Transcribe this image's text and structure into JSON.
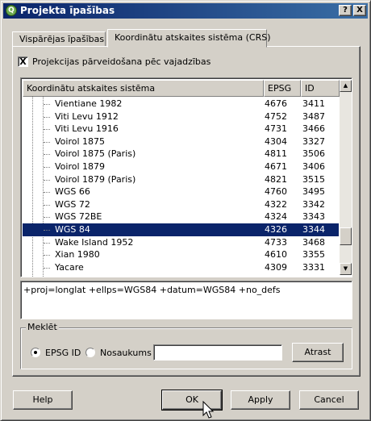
{
  "window": {
    "title": "Projekta īpašības"
  },
  "titlebar_buttons": {
    "help": "?",
    "close": "X"
  },
  "tabs": [
    {
      "label": "Vispārējas īpašības"
    },
    {
      "label": "Koordinātu atskaites sistēma (CRS)"
    }
  ],
  "on_the_fly": {
    "label": "Projekcijas pārveidošana pēc vajadzības",
    "checked": "X"
  },
  "crs_table": {
    "headers": [
      "Koordinātu atskaites sistēma",
      "EPSG",
      "ID"
    ],
    "rows": [
      {
        "name": "Vientiane 1982",
        "epsg": "4676",
        "id": "3411"
      },
      {
        "name": "Viti Levu 1912",
        "epsg": "4752",
        "id": "3487"
      },
      {
        "name": "Viti Levu 1916",
        "epsg": "4731",
        "id": "3466"
      },
      {
        "name": "Voirol 1875",
        "epsg": "4304",
        "id": "3327"
      },
      {
        "name": "Voirol 1875 (Paris)",
        "epsg": "4811",
        "id": "3506"
      },
      {
        "name": "Voirol 1879",
        "epsg": "4671",
        "id": "3406"
      },
      {
        "name": "Voirol 1879 (Paris)",
        "epsg": "4821",
        "id": "3515"
      },
      {
        "name": "WGS 66",
        "epsg": "4760",
        "id": "3495"
      },
      {
        "name": "WGS 72",
        "epsg": "4322",
        "id": "3342"
      },
      {
        "name": "WGS 72BE",
        "epsg": "4324",
        "id": "3343"
      },
      {
        "name": "WGS 84",
        "epsg": "4326",
        "id": "3344"
      },
      {
        "name": "Wake Island 1952",
        "epsg": "4733",
        "id": "3468"
      },
      {
        "name": "Xian 1980",
        "epsg": "4610",
        "id": "3355"
      },
      {
        "name": "Yacare",
        "epsg": "4309",
        "id": "3331"
      }
    ],
    "selected": "WGS 84"
  },
  "proj_string": "+proj=longlat +ellps=WGS84 +datum=WGS84 +no_defs",
  "search": {
    "legend": "Meklēt",
    "epsg_label": "EPSG ID",
    "name_label": "Nosaukums",
    "value": "",
    "find_label": "Atrast"
  },
  "buttons": {
    "help": "Help",
    "ok": "OK",
    "apply": "Apply",
    "cancel": "Cancel"
  },
  "colors": {
    "selection": "#0a246a",
    "face": "#d4d0c8"
  }
}
